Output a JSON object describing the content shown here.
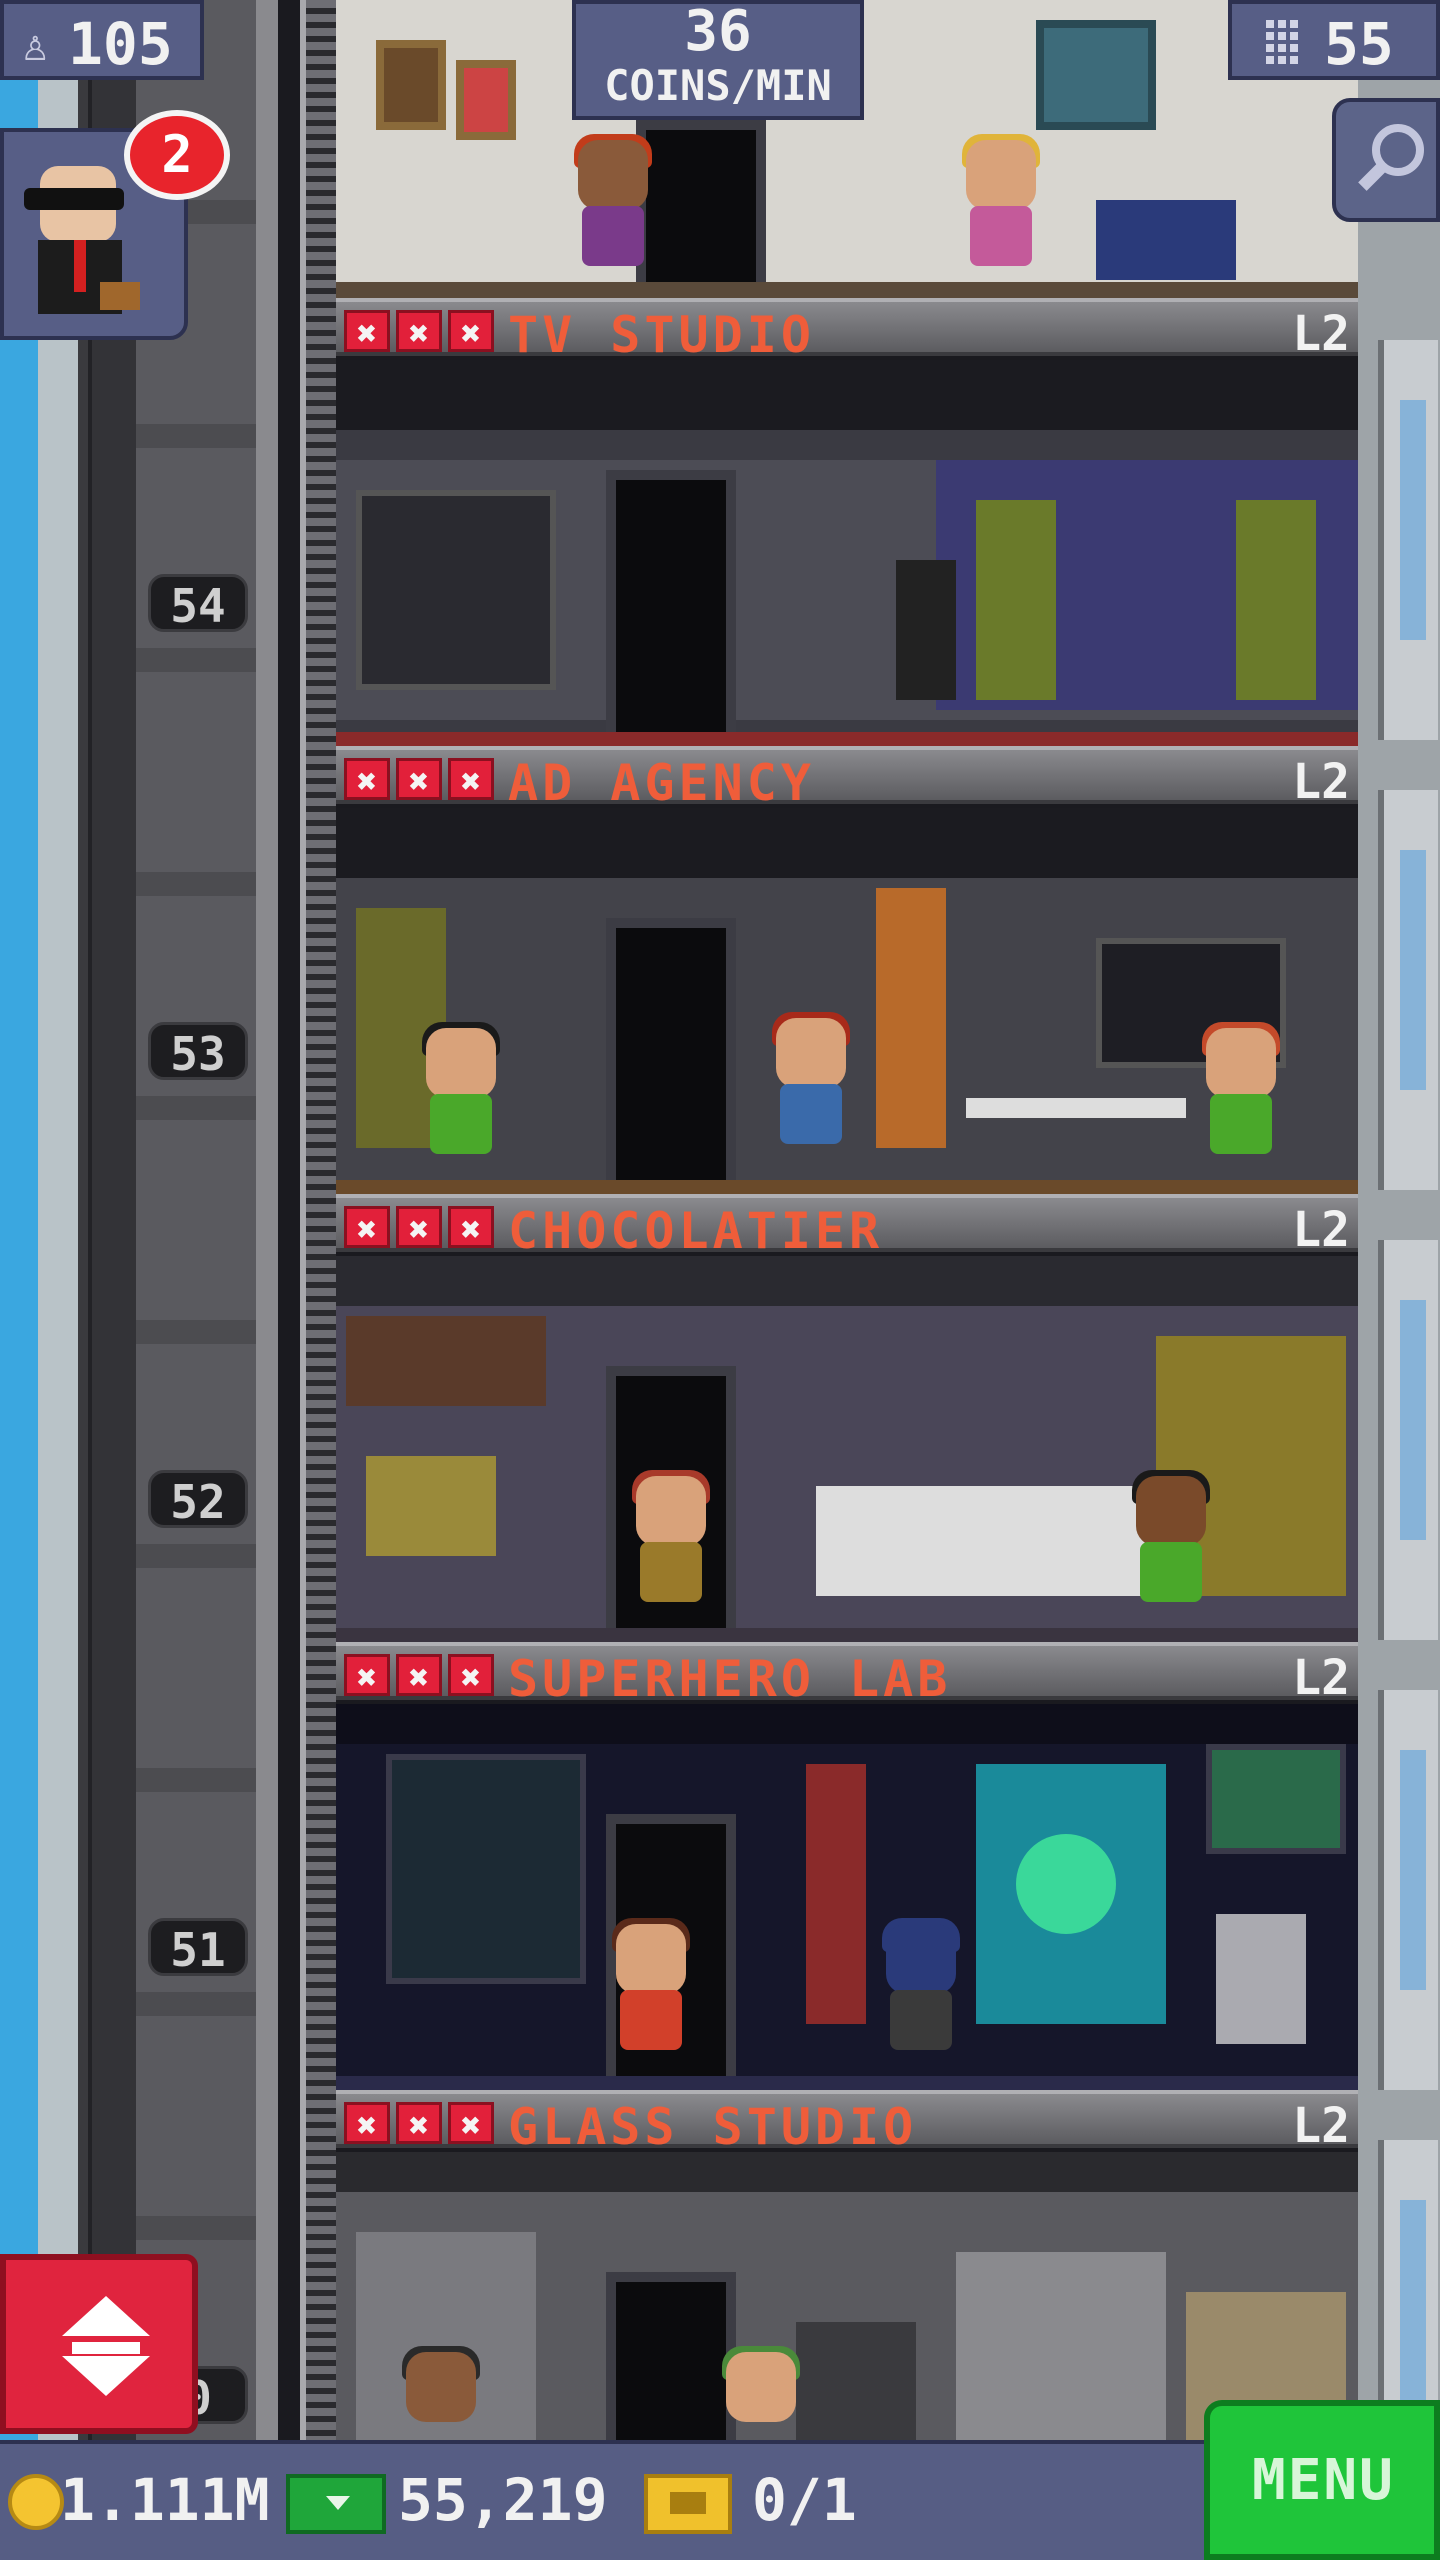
{
  "hud": {
    "population": "105",
    "coins_per_min": "36",
    "coins_per_min_label": "COINS/MIN",
    "floor_count": "55",
    "vip_badge": "2"
  },
  "shaft": {
    "floor_numbers": [
      "54",
      "53",
      "52",
      "51",
      "0"
    ]
  },
  "floors": [
    {
      "name": "TV STUDIO",
      "level": "L2",
      "stars": [
        "✖",
        "✖",
        "✖"
      ]
    },
    {
      "name": "AD AGENCY",
      "level": "L2",
      "stars": [
        "✖",
        "✖",
        "✖"
      ]
    },
    {
      "name": "CHOCOLATIER",
      "level": "L2",
      "stars": [
        "✖",
        "✖",
        "✖"
      ]
    },
    {
      "name": "SUPERHERO LAB",
      "level": "L2",
      "stars": [
        "✖",
        "✖",
        "✖"
      ]
    },
    {
      "name": "GLASS STUDIO",
      "level": "L2",
      "stars": [
        "✖",
        "✖",
        "✖"
      ]
    }
  ],
  "bottom_bar": {
    "coins": "1.111M",
    "bux": "55,219",
    "tickets": "0/1",
    "menu_label": "MENU"
  },
  "colors": {
    "hud_panel": "#575e86",
    "banner_name": "#ef5d3a",
    "star_bad": "#e2203a",
    "menu_green": "#1fc53a",
    "lift_red": "#e0243e",
    "sky": "#3aa7e0"
  },
  "icons": {
    "population": "person-icon",
    "floors": "building-icon",
    "search": "magnifier-icon",
    "coin": "coin-icon",
    "bux": "bux-icon",
    "ticket": "ticket-icon",
    "elevator": "up-down-arrows-icon"
  }
}
